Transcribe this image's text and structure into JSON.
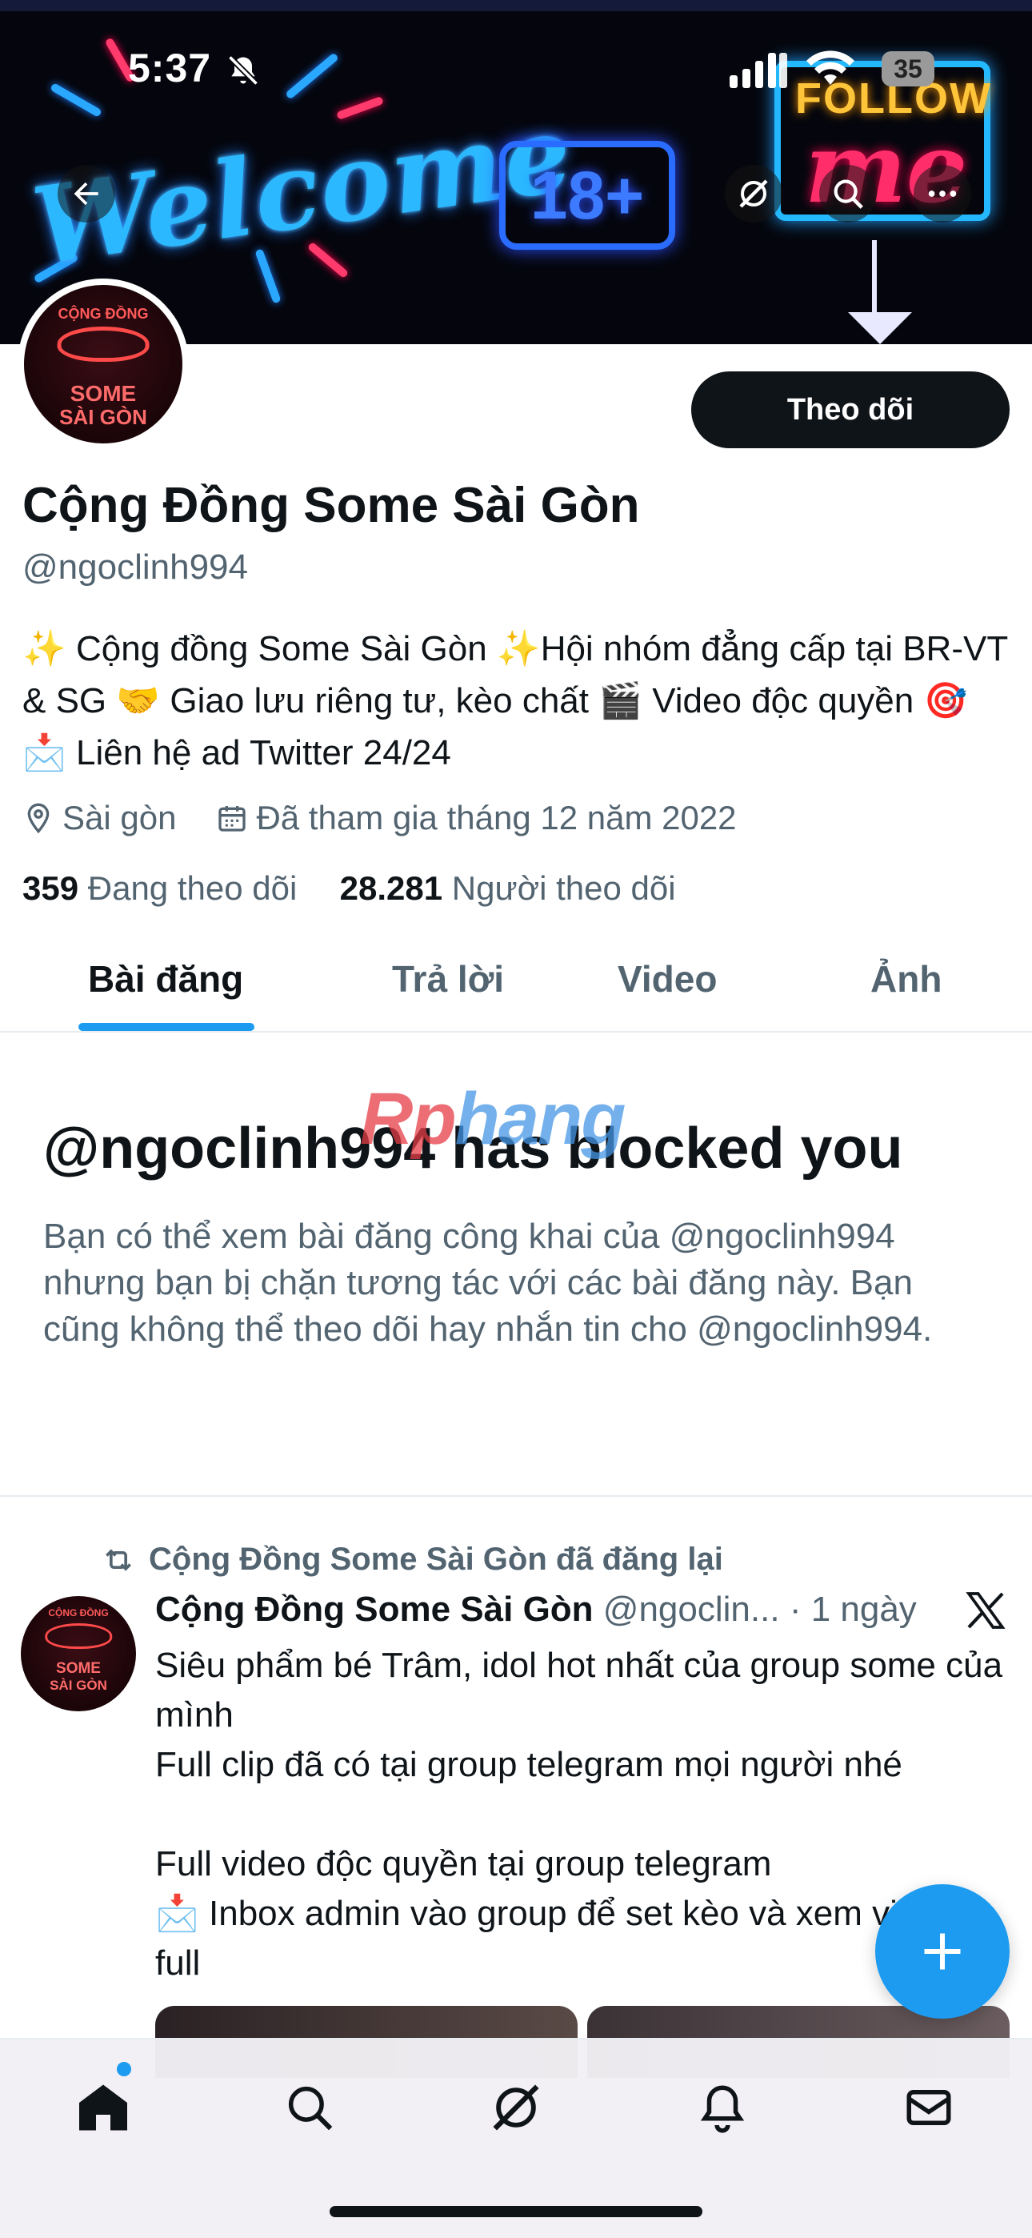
{
  "status_bar": {
    "time": "5:37",
    "battery": "35"
  },
  "banner": {
    "welcome_text": "Welcome",
    "sign_18": "18+",
    "follow_text": "FOLLOW",
    "me_text": "me"
  },
  "header_icons": [
    "back-arrow-icon",
    "grok-icon",
    "search-icon",
    "more-icon"
  ],
  "profile": {
    "avatar_text_top": "CỘNG ĐỒNG",
    "avatar_text_bottom1": "SOME",
    "avatar_text_bottom2": "SÀI GÒN",
    "follow_button": "Theo dõi",
    "display_name": "Cộng Đồng Some Sài Gòn",
    "handle": "@ngoclinh994",
    "bio": "✨ Cộng đồng Some Sài Gòn ✨Hội nhóm đẳng cấp tại BR-VT & SG 🤝 Giao lưu riêng tư, kèo chất 🎬 Video độc quyền 🎯 📩 Liên hệ ad Twitter 24/24",
    "location": "Sài gòn",
    "joined": "Đã tham gia tháng 12 năm 2022",
    "following_count": "359",
    "following_label": "Đang theo dõi",
    "followers_count": "28.281",
    "followers_label": "Người theo dõi"
  },
  "tabs": [
    {
      "label": "Bài đăng",
      "active": true
    },
    {
      "label": "Trả lời",
      "active": false
    },
    {
      "label": "Video",
      "active": false
    },
    {
      "label": "Ảnh",
      "active": false
    }
  ],
  "watermark": {
    "part1": "Rp",
    "part2": "hang"
  },
  "blocked": {
    "title": "@ngoclinh994 has blocked you",
    "description": "Bạn có thể xem bài đăng công khai của @ngoclinh994 nhưng bạn bị chặn tương tác với các bài đăng này. Bạn cũng không thể theo dõi hay nhắn tin cho @ngoclinh994."
  },
  "post": {
    "repost_label": "Cộng Đồng Some Sài Gòn đã đăng lại",
    "author_name": "Cộng Đồng Some Sài Gòn",
    "author_handle": "@ngoclin...",
    "separator": "·",
    "time": "1 ngày",
    "lines": [
      "Siêu phẩm bé Trâm, idol hot nhất của group some của mình",
      "Full clip đã có tại group telegram mọi người nhé",
      "",
      "Full video độc quyền tại group telegram",
      "📩 Inbox admin vào group để set kèo và xem video full"
    ]
  },
  "bottom_nav": [
    "home-icon",
    "search-icon",
    "grok-icon",
    "notifications-icon",
    "messages-icon"
  ],
  "colors": {
    "accent": "#1d9bf0",
    "text": "#0f1419",
    "secondary": "#536471",
    "button": "#0f1419"
  }
}
